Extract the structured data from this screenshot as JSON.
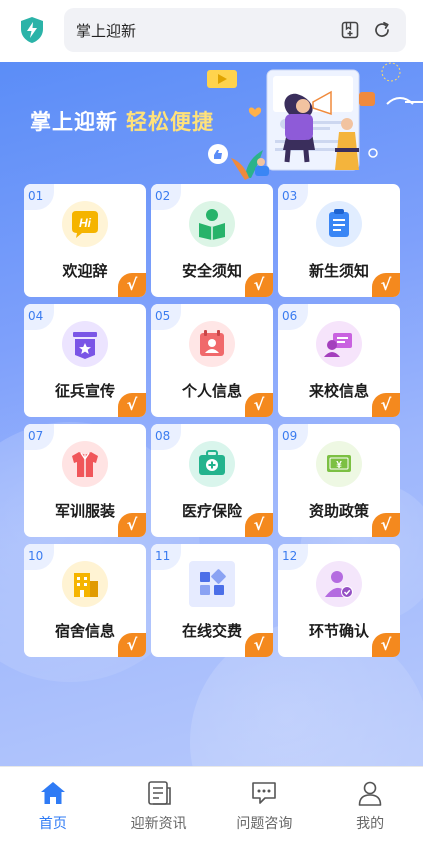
{
  "header": {
    "title": "掌上迎新",
    "icons": [
      "shield-icon",
      "bookmark-add-icon",
      "refresh-icon"
    ]
  },
  "hero": {
    "title_main": "掌上迎新",
    "title_accent": "轻松便捷"
  },
  "grid": {
    "items": [
      {
        "num": "01",
        "label": "欢迎辞",
        "icon": "hi-icon",
        "color": "#f5b400"
      },
      {
        "num": "02",
        "label": "安全须知",
        "icon": "reading-person-icon",
        "color": "#27b36a"
      },
      {
        "num": "03",
        "label": "新生须知",
        "icon": "clipboard-icon",
        "color": "#3a86f5"
      },
      {
        "num": "04",
        "label": "征兵宣传",
        "icon": "military-badge-icon",
        "color": "#7a55e6"
      },
      {
        "num": "05",
        "label": "个人信息",
        "icon": "calendar-person-icon",
        "color": "#f0696b"
      },
      {
        "num": "06",
        "label": "来校信息",
        "icon": "id-card-icon",
        "color": "#c962e0"
      },
      {
        "num": "07",
        "label": "军训服装",
        "icon": "uniform-icon",
        "color": "#f0565a"
      },
      {
        "num": "08",
        "label": "医疗保险",
        "icon": "medical-kit-icon",
        "color": "#23b38d"
      },
      {
        "num": "09",
        "label": "资助政策",
        "icon": "money-icon",
        "color": "#7cc043"
      },
      {
        "num": "10",
        "label": "宿舍信息",
        "icon": "building-icon",
        "color": "#f5b400"
      },
      {
        "num": "11",
        "label": "在线交费",
        "icon": "apps-grid-icon",
        "color": "#4c6fe8"
      },
      {
        "num": "12",
        "label": "环节确认",
        "icon": "person-check-icon",
        "color": "#b46be0"
      }
    ],
    "check_mark": "√"
  },
  "tabbar": {
    "items": [
      {
        "label": "首页",
        "icon": "home-icon",
        "active": true
      },
      {
        "label": "迎新资讯",
        "icon": "news-icon",
        "active": false
      },
      {
        "label": "问题咨询",
        "icon": "chat-icon",
        "active": false
      },
      {
        "label": "我的",
        "icon": "user-icon",
        "active": false
      }
    ]
  },
  "colors": {
    "accent": "#2f7bf5",
    "check_badge": "#f4891e",
    "number_text": "#3b7cf0",
    "hero_accent": "#ffe27a"
  }
}
